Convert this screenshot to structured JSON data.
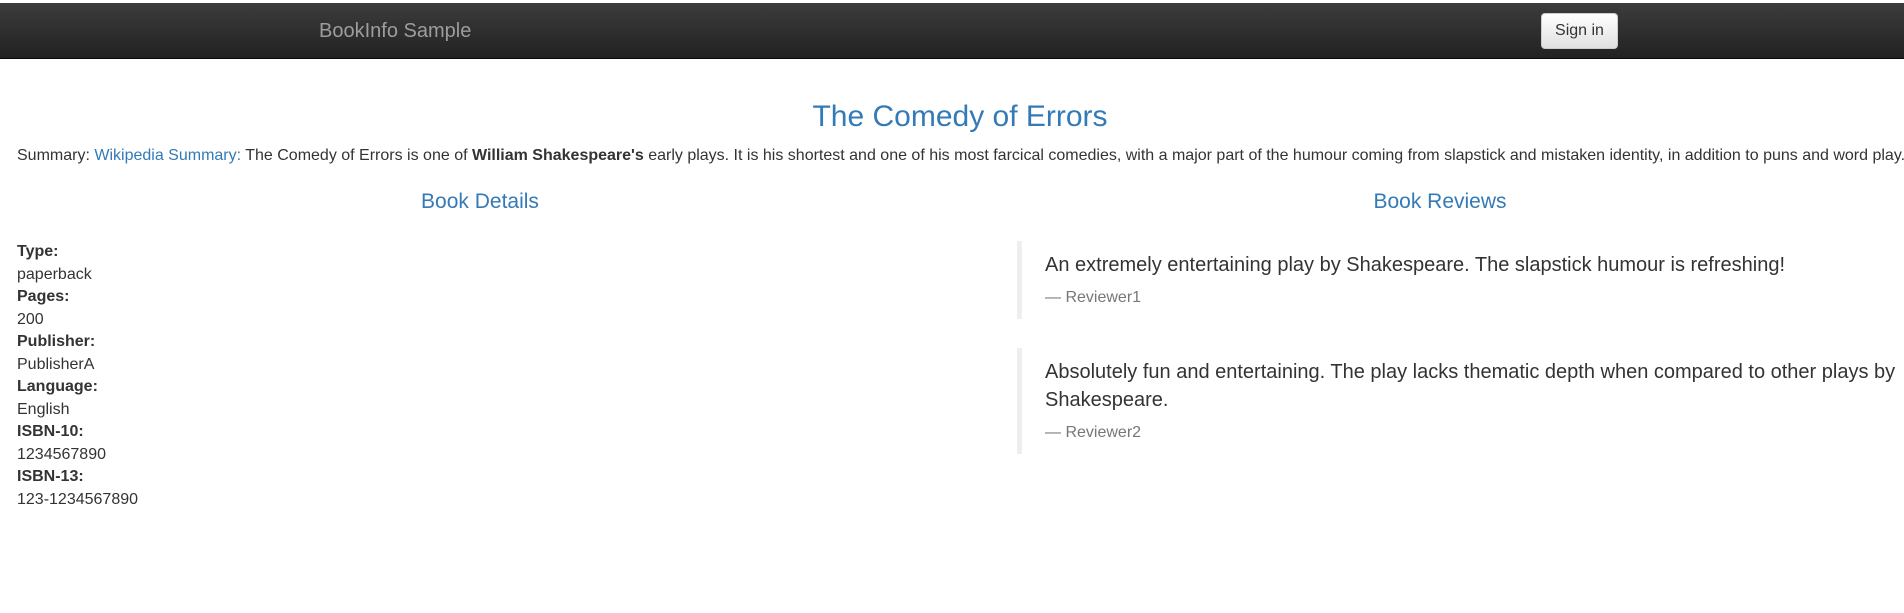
{
  "navbar": {
    "brand": "BookInfo Sample",
    "signin_label": "Sign in"
  },
  "book": {
    "title": "The Comedy of Errors",
    "summary": {
      "label": "Summary:",
      "link_text": "Wikipedia Summary:",
      "text_before": "The Comedy of Errors is one of",
      "author_bold": "William Shakespeare's",
      "text_after": "early plays. It is his shortest and one of his most farcical comedies, with a major part of the humour coming from slapstick and mistaken identity, in addition to puns and word play."
    }
  },
  "details": {
    "heading": "Book Details",
    "items": [
      {
        "label": "Type:",
        "value": "paperback"
      },
      {
        "label": "Pages:",
        "value": "200"
      },
      {
        "label": "Publisher:",
        "value": "PublisherA"
      },
      {
        "label": "Language:",
        "value": "English"
      },
      {
        "label": "ISBN-10:",
        "value": "1234567890"
      },
      {
        "label": "ISBN-13:",
        "value": "123-1234567890"
      }
    ]
  },
  "reviews": {
    "heading": "Book Reviews",
    "items": [
      {
        "text": "An extremely entertaining play by Shakespeare. The slapstick humour is refreshing!",
        "author": "Reviewer1"
      },
      {
        "text": "Absolutely fun and entertaining. The play lacks thematic depth when compared to other plays by Shakespeare.",
        "author": "Reviewer2"
      }
    ]
  },
  "colors": {
    "navbar_bg": "#222222",
    "brand_text": "#9d9d9d",
    "accent_link": "#337ab7",
    "muted_text": "#777777",
    "blockquote_border": "#eeeeee"
  }
}
